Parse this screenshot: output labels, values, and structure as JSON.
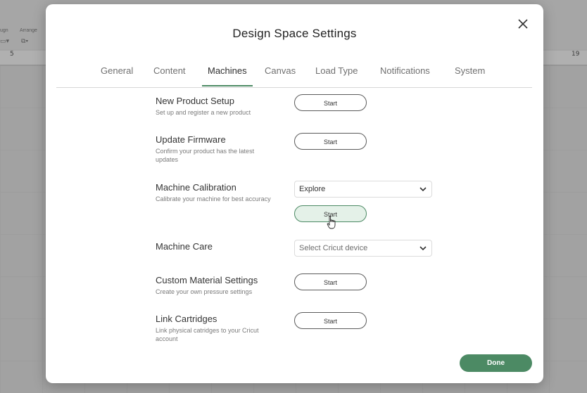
{
  "background": {
    "toolbar_labels": [
      "ugn",
      "Arrange"
    ],
    "ruler_ticks": [
      "5",
      "19"
    ]
  },
  "modal": {
    "title": "Design Space Settings",
    "close_icon": "close-icon"
  },
  "tabs": [
    {
      "label": "General",
      "active": false
    },
    {
      "label": "Content",
      "active": false
    },
    {
      "label": "Machines",
      "active": true
    },
    {
      "label": "Canvas",
      "active": false
    },
    {
      "label": "Load Type",
      "active": false
    },
    {
      "label": "Notifications",
      "active": false
    },
    {
      "label": "System",
      "active": false
    }
  ],
  "rows": {
    "new_product": {
      "title": "New Product Setup",
      "desc": "Set up and register a new product",
      "button": "Start"
    },
    "firmware": {
      "title": "Update Firmware",
      "desc": "Confirm your product has the latest updates",
      "button": "Start"
    },
    "calibration": {
      "title": "Machine Calibration",
      "desc": "Calibrate your machine for best accuracy",
      "select_value": "Explore",
      "button": "Start"
    },
    "care": {
      "title": "Machine Care",
      "select_placeholder": "Select Cricut device"
    },
    "custom_material": {
      "title": "Custom Material Settings",
      "desc": "Create your own pressure settings",
      "button": "Start"
    },
    "cartridges": {
      "title": "Link Cartridges",
      "desc": "Link physical catridges to your Cricut account",
      "button": "Start"
    }
  },
  "footer": {
    "done_label": "Done"
  },
  "colors": {
    "accent": "#4c8a64",
    "hover_fill": "#e4f1e8"
  }
}
